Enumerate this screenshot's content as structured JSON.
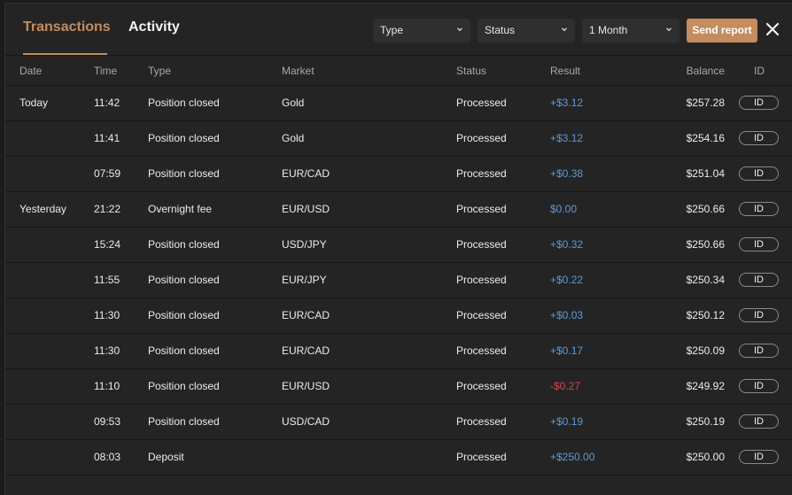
{
  "tabs": [
    {
      "label": "Transactions",
      "active": true
    },
    {
      "label": "Activity",
      "active": false
    }
  ],
  "filters": {
    "type": {
      "selected": "Type"
    },
    "status": {
      "selected": "Status"
    },
    "period": {
      "selected": "1 Month"
    }
  },
  "actions": {
    "send_report_label": "Send report",
    "close_icon": "close-icon"
  },
  "colors": {
    "accent": "#c48c5f",
    "positive": "#5b9bd5",
    "negative": "#d9434f"
  },
  "table": {
    "columns": [
      "Date",
      "Time",
      "Type",
      "Market",
      "Status",
      "Result",
      "Balance",
      "ID"
    ],
    "rows": [
      {
        "date": "Today",
        "time": "11:42",
        "type": "Position closed",
        "market": "Gold",
        "status": "Processed",
        "result": "+$3.12",
        "sign": "pos",
        "balance": "$257.28",
        "id_label": "ID"
      },
      {
        "date": "",
        "time": "11:41",
        "type": "Position closed",
        "market": "Gold",
        "status": "Processed",
        "result": "+$3.12",
        "sign": "pos",
        "balance": "$254.16",
        "id_label": "ID"
      },
      {
        "date": "",
        "time": "07:59",
        "type": "Position closed",
        "market": "EUR/CAD",
        "status": "Processed",
        "result": "+$0.38",
        "sign": "pos",
        "balance": "$251.04",
        "id_label": "ID"
      },
      {
        "date": "Yesterday",
        "time": "21:22",
        "type": "Overnight fee",
        "market": "EUR/USD",
        "status": "Processed",
        "result": "$0.00",
        "sign": "pos",
        "balance": "$250.66",
        "id_label": "ID"
      },
      {
        "date": "",
        "time": "15:24",
        "type": "Position closed",
        "market": "USD/JPY",
        "status": "Processed",
        "result": "+$0.32",
        "sign": "pos",
        "balance": "$250.66",
        "id_label": "ID"
      },
      {
        "date": "",
        "time": "11:55",
        "type": "Position closed",
        "market": "EUR/JPY",
        "status": "Processed",
        "result": "+$0.22",
        "sign": "pos",
        "balance": "$250.34",
        "id_label": "ID"
      },
      {
        "date": "",
        "time": "11:30",
        "type": "Position closed",
        "market": "EUR/CAD",
        "status": "Processed",
        "result": "+$0.03",
        "sign": "pos",
        "balance": "$250.12",
        "id_label": "ID"
      },
      {
        "date": "",
        "time": "11:30",
        "type": "Position closed",
        "market": "EUR/CAD",
        "status": "Processed",
        "result": "+$0.17",
        "sign": "pos",
        "balance": "$250.09",
        "id_label": "ID"
      },
      {
        "date": "",
        "time": "11:10",
        "type": "Position closed",
        "market": "EUR/USD",
        "status": "Processed",
        "result": "-$0.27",
        "sign": "neg",
        "balance": "$249.92",
        "id_label": "ID"
      },
      {
        "date": "",
        "time": "09:53",
        "type": "Position closed",
        "market": "USD/CAD",
        "status": "Processed",
        "result": "+$0.19",
        "sign": "pos",
        "balance": "$250.19",
        "id_label": "ID"
      },
      {
        "date": "",
        "time": "08:03",
        "type": "Deposit",
        "market": "",
        "status": "Processed",
        "result": "+$250.00",
        "sign": "pos",
        "balance": "$250.00",
        "id_label": "ID"
      }
    ]
  }
}
